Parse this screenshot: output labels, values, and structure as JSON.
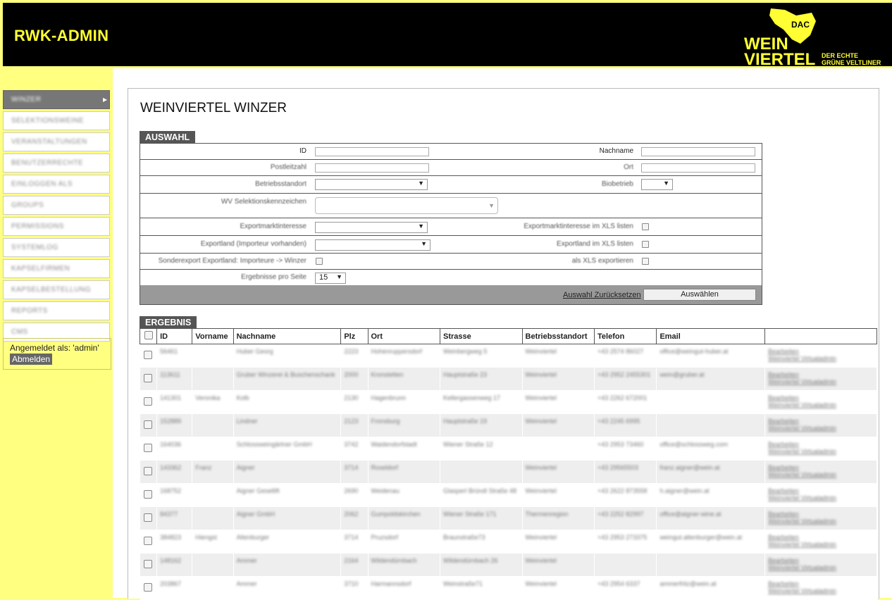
{
  "header": {
    "app_title": "RWK-ADMIN"
  },
  "logo": {
    "badge": "DAC",
    "line1": "WEIN",
    "line2": "VIERTEL",
    "tagline1": "DER ECHTE",
    "tagline2": "GRÜNE VELTLINER"
  },
  "sidebar": {
    "items": [
      {
        "label": "WINZER",
        "active": true
      },
      {
        "label": "SELEKTIONSWEINE"
      },
      {
        "label": "VERANSTALTUNGEN"
      },
      {
        "label": "BENUTZERRECHTE"
      },
      {
        "label": "EINLOGGEN ALS"
      },
      {
        "label": "GROUPS"
      },
      {
        "label": "PERMISSIONS"
      },
      {
        "label": "SYSTEMLOG"
      },
      {
        "label": "KAPSELFIRMEN"
      },
      {
        "label": "KAPSELBESTELLUNG"
      },
      {
        "label": "REPORTS"
      },
      {
        "label": "CMS"
      }
    ],
    "logged_in_label": "Angemeldet als: 'admin'",
    "logout_label": "Abmelden"
  },
  "page": {
    "title": "WEINVIERTEL WINZER"
  },
  "auswahl": {
    "section_label": "AUSWAHL",
    "id_label": "ID",
    "nachname_label": "Nachname",
    "plz_label": "Postleitzahl",
    "ort_label": "Ort",
    "betriebsstandort_label": "Betriebsstandort",
    "biobetrieb_label": "Biobetrieb",
    "wv_label": "WV Selektionskennzeichen",
    "exportmarkt_label": "Exportmarktinteresse",
    "exportmarkt_xls_label": "Exportmarktinteresse im XLS listen",
    "exportland_label": "Exportland (Importeur vorhanden)",
    "exportland_xls_label": "Exportland im XLS listen",
    "sonderexport_label": "Sonderexport Exportland: Importeure -> Winzer",
    "xls_export_label": "als XLS exportieren",
    "ergebnisse_label": "Ergebnisse pro Seite",
    "ergebnisse_value": "15",
    "reset_label": "Auswahl Zurücksetzen",
    "select_label": "Auswählen"
  },
  "ergebnis": {
    "section_label": "ERGEBNIS",
    "columns": [
      "ID",
      "Vorname",
      "Nachname",
      "Plz",
      "Ort",
      "Strasse",
      "Betriebsstandort",
      "Telefon",
      "Email",
      ""
    ],
    "action_edit": "Bearbeiten",
    "action_admin": "Weinviertel Virtualadmin",
    "rows": [
      {
        "id": "56461",
        "vorname": "",
        "nachname": "Huber Georg",
        "plz": "2223",
        "ort": "Hohenruppersdorf",
        "strasse": "Weinbergweg 5",
        "betrieb": "Weinviertel",
        "telefon": "+43 2574 86027",
        "email": "office@weingut-huber.at"
      },
      {
        "id": "113611",
        "vorname": "",
        "nachname": "Gruber Winzerei & Buschenschank",
        "plz": "2000",
        "ort": "Kronstetten",
        "strasse": "Hauptstraße 23",
        "betrieb": "Weinviertel",
        "telefon": "+43 2952 2455301",
        "email": "wein@gruber.at"
      },
      {
        "id": "141301",
        "vorname": "Veronika",
        "nachname": "Kolb",
        "plz": "2130",
        "ort": "Hagenbrunn",
        "strasse": "Kellergassenweg 17",
        "betrieb": "Weinviertel",
        "telefon": "+43 2262 672001",
        "email": ""
      },
      {
        "id": "152889",
        "vorname": "",
        "nachname": "Lindner",
        "plz": "2123",
        "ort": "Fronsburg",
        "strasse": "Hauptstraße 19",
        "betrieb": "Weinviertel",
        "telefon": "+43 2245 6995",
        "email": ""
      },
      {
        "id": "164036",
        "vorname": "",
        "nachname": "Schlossweingärtner GmbH",
        "plz": "3742",
        "ort": "Waidendorfstadt",
        "strasse": "Wiener Straße 12",
        "betrieb": "",
        "telefon": "+43 2953 73460",
        "email": "office@schlossweg.com"
      },
      {
        "id": "143362",
        "vorname": "Franz",
        "nachname": "Aigner",
        "plz": "3714",
        "ort": "Roseldorf",
        "strasse": "",
        "betrieb": "Weinviertel",
        "telefon": "+43 29565503",
        "email": "franz.aigner@wein.at"
      },
      {
        "id": "168752",
        "vorname": "",
        "nachname": "Aigner Gesellift",
        "plz": "2690",
        "ort": "Weidenau",
        "strasse": "Glasperl Bründl Straße 48",
        "betrieb": "Weinviertel",
        "telefon": "+43 2622 873558",
        "email": "h.aigner@wein.at"
      },
      {
        "id": "84377",
        "vorname": "",
        "nachname": "Aigner GmbH",
        "plz": "2062",
        "ort": "Gumpoldskirchen",
        "strasse": "Wiener Straße 171",
        "betrieb": "Thermenregion",
        "telefon": "+43 2252 82997",
        "email": "office@aigner-wine.at"
      },
      {
        "id": "384823",
        "vorname": "Hiengst",
        "nachname": "Altenburger",
        "plz": "3714",
        "ort": "Pruzsdorf",
        "strasse": "Braunstraße73",
        "betrieb": "Weinviertel",
        "telefon": "+43 2953 273375",
        "email": "weingut.altenburger@wein.at"
      },
      {
        "id": "148162",
        "vorname": "",
        "nachname": "Ammer",
        "plz": "2164",
        "ort": "Wildendürnbach",
        "strasse": "Wildendürnbach 26",
        "betrieb": "Weinviertel",
        "telefon": "",
        "email": ""
      },
      {
        "id": "203867",
        "vorname": "",
        "nachname": "Ammer",
        "plz": "3710",
        "ort": "Harmannsdorf",
        "strasse": "Weinstraße71",
        "betrieb": "Weinviertel",
        "telefon": "+43 2954 6337",
        "email": "ammerfritz@wein.at"
      }
    ]
  }
}
